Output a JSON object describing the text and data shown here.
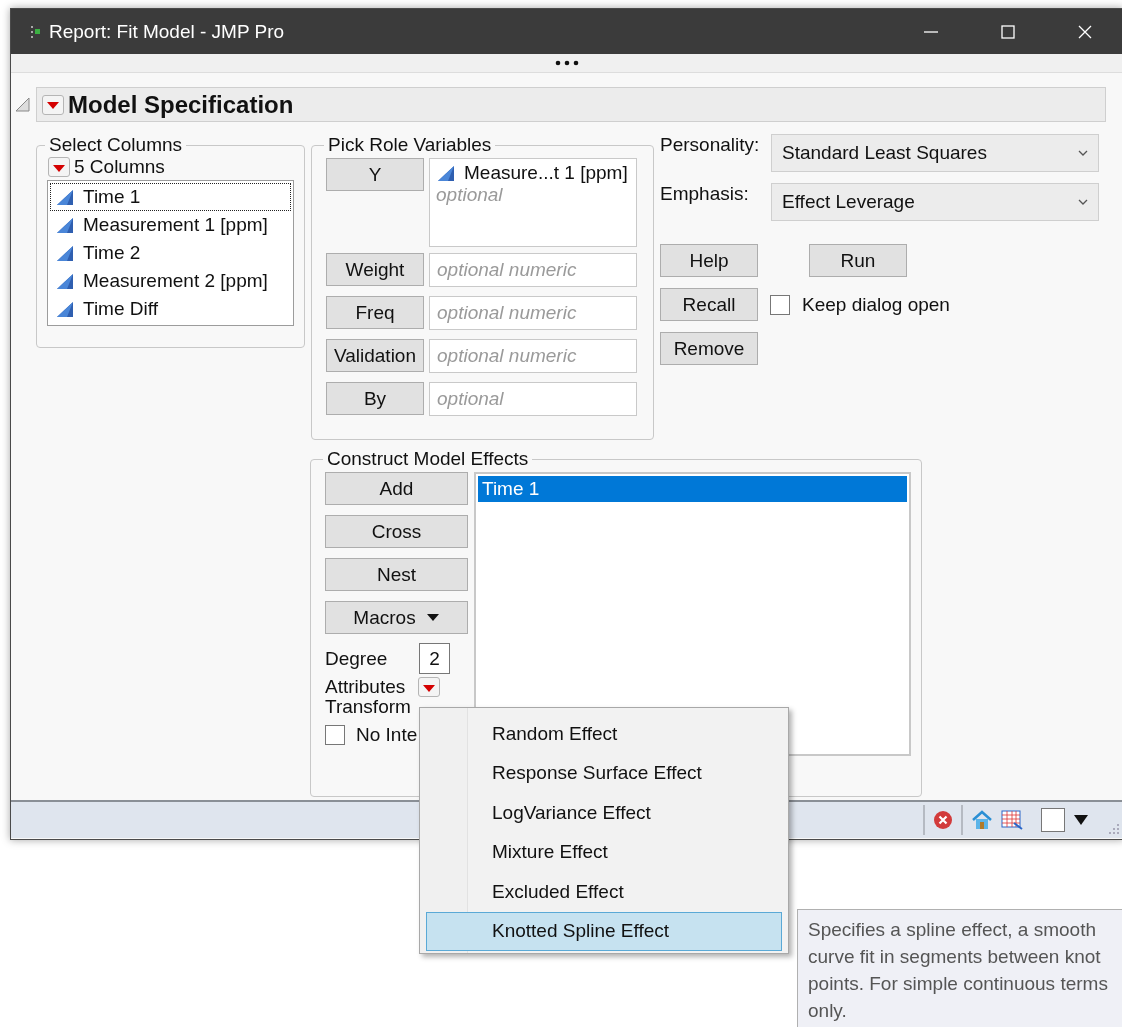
{
  "window": {
    "title": "Report: Fit Model - JMP Pro"
  },
  "outline": {
    "title": "Model Specification",
    "expanded": true
  },
  "select_columns": {
    "title": "Select Columns",
    "count": "5 Columns",
    "columns": [
      {
        "name": "Time 1",
        "focused": true
      },
      {
        "name": "Measurement 1 [ppm]",
        "focused": false
      },
      {
        "name": "Time 2",
        "focused": false
      },
      {
        "name": "Measurement 2 [ppm]",
        "focused": false
      },
      {
        "name": "Time Diff",
        "focused": false
      }
    ]
  },
  "roles": {
    "title": "Pick Role Variables",
    "items": [
      {
        "button": "Y",
        "values": [
          "Measure...t 1 [ppm]"
        ],
        "placeholder": "optional"
      },
      {
        "button": "Weight",
        "placeholder": "optional numeric"
      },
      {
        "button": "Freq",
        "placeholder": "optional numeric"
      },
      {
        "button": "Validation",
        "placeholder": "optional numeric"
      },
      {
        "button": "By",
        "placeholder": "optional"
      }
    ]
  },
  "personality": {
    "label": "Personality:",
    "value": "Standard Least Squares"
  },
  "emphasis": {
    "label": "Emphasis:",
    "value": "Effect Leverage"
  },
  "actions": {
    "help": "Help",
    "run": "Run",
    "recall": "Recall",
    "remove": "Remove"
  },
  "keep_open": {
    "label": "Keep dialog open",
    "checked": false
  },
  "effects": {
    "title": "Construct Model Effects",
    "buttons": [
      {
        "label": "Add",
        "kind": "plain"
      },
      {
        "label": "Cross",
        "kind": "plain"
      },
      {
        "label": "Nest",
        "kind": "plain"
      },
      {
        "label": "Macros",
        "kind": "menu"
      }
    ],
    "degree": {
      "label": "Degree",
      "value": "2"
    },
    "attributes": {
      "label": "Attributes"
    },
    "transform": {
      "label": "Transform"
    },
    "no_intercept": {
      "label": "No Inte",
      "checked": false
    },
    "list": [
      {
        "name": "Time 1",
        "selected": true
      }
    ]
  },
  "menu": {
    "items": [
      {
        "label": "Random Effect",
        "selected": false
      },
      {
        "label": "Response Surface Effect",
        "selected": false
      },
      {
        "label": "LogVariance Effect",
        "selected": false
      },
      {
        "label": "Mixture Effect",
        "selected": false
      },
      {
        "label": "Excluded Effect",
        "selected": false
      },
      {
        "label": "Knotted Spline Effect",
        "selected": true
      }
    ]
  },
  "tooltip": {
    "text": "Specifies a spline effect, a smooth curve fit in segments between knot points. For simple continuous terms only."
  }
}
